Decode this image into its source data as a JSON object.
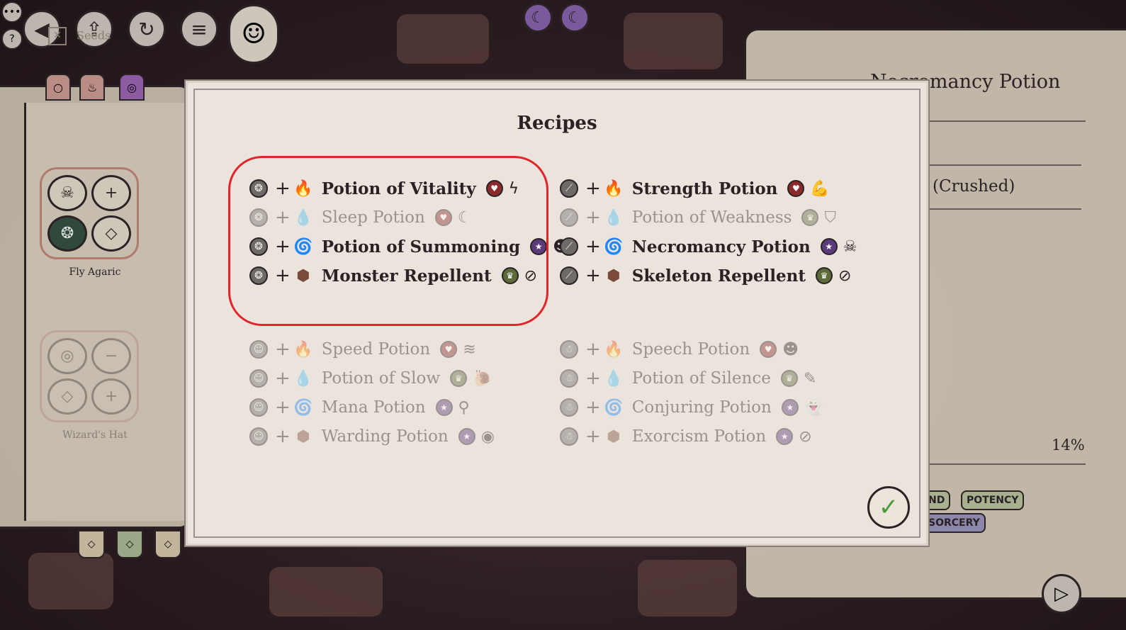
{
  "hud": {
    "back_icon": "◀",
    "upload_icon": "⇪",
    "restart_icon": "↻",
    "menu_icon": "≡",
    "more_icon": "•••",
    "help_icon": "?",
    "portrait_icon": "☺",
    "moon_icon": "☾"
  },
  "left_book": {
    "section_label": "Seeds",
    "ingredients": [
      {
        "name": "Fly Agaric"
      },
      {
        "name": "Wizard's Hat"
      }
    ]
  },
  "right_page": {
    "title": "Necromancy Potion",
    "ingredient_text": "(Crushed)",
    "percent": "14%",
    "tags": [
      "ND",
      "POTENCY",
      "SORCERY"
    ]
  },
  "modal": {
    "title": "Recipes",
    "confirm_icon": "✓"
  },
  "recipes": [
    {
      "name": "Potion of Vitality",
      "base_icon": "❂",
      "elem_icon": "🔥",
      "effect_icon": "♥",
      "effect_color": "#8b2a2a",
      "result_icon": "ϟ",
      "known": true
    },
    {
      "name": "Sleep Potion",
      "base_icon": "❂",
      "elem_icon": "💧",
      "effect_icon": "♥",
      "effect_color": "#8b2a2a",
      "result_icon": "☾",
      "known": false
    },
    {
      "name": "Potion of Summoning",
      "base_icon": "❂",
      "elem_icon": "🌀",
      "effect_icon": "★",
      "effect_color": "#5b3a7a",
      "result_icon": "☻",
      "known": true
    },
    {
      "name": "Monster Repellent",
      "base_icon": "❂",
      "elem_icon": "⬢",
      "effect_icon": "♛",
      "effect_color": "#5d6a3a",
      "result_icon": "⊘",
      "known": true
    },
    {
      "name": "Strength Potion",
      "base_icon": "⟋",
      "elem_icon": "🔥",
      "effect_icon": "♥",
      "effect_color": "#8b2a2a",
      "result_icon": "💪",
      "known": true
    },
    {
      "name": "Potion of Weakness",
      "base_icon": "⟋",
      "elem_icon": "💧",
      "effect_icon": "♛",
      "effect_color": "#5d6a3a",
      "result_icon": "⛉",
      "known": false
    },
    {
      "name": "Necromancy Potion",
      "base_icon": "⟋",
      "elem_icon": "🌀",
      "effect_icon": "★",
      "effect_color": "#5b3a7a",
      "result_icon": "☠",
      "known": true
    },
    {
      "name": "Skeleton Repellent",
      "base_icon": "⟋",
      "elem_icon": "⬢",
      "effect_icon": "♛",
      "effect_color": "#5d6a3a",
      "result_icon": "⊘",
      "known": true
    },
    {
      "name": "Speed Potion",
      "base_icon": "☺",
      "elem_icon": "🔥",
      "effect_icon": "♥",
      "effect_color": "#8b2a2a",
      "result_icon": "≋",
      "known": false
    },
    {
      "name": "Potion of Slow",
      "base_icon": "☺",
      "elem_icon": "💧",
      "effect_icon": "♛",
      "effect_color": "#5d6a3a",
      "result_icon": "🐌",
      "known": false
    },
    {
      "name": "Mana Potion",
      "base_icon": "☺",
      "elem_icon": "🌀",
      "effect_icon": "★",
      "effect_color": "#5b3a7a",
      "result_icon": "⚲",
      "known": false
    },
    {
      "name": "Warding Potion",
      "base_icon": "☺",
      "elem_icon": "⬢",
      "effect_icon": "★",
      "effect_color": "#5b3a7a",
      "result_icon": "◉",
      "known": false
    },
    {
      "name": "Speech Potion",
      "base_icon": "☃",
      "elem_icon": "🔥",
      "effect_icon": "♥",
      "effect_color": "#8b2a2a",
      "result_icon": "☻",
      "known": false
    },
    {
      "name": "Potion of Silence",
      "base_icon": "☃",
      "elem_icon": "💧",
      "effect_icon": "♛",
      "effect_color": "#5d6a3a",
      "result_icon": "✎",
      "known": false
    },
    {
      "name": "Conjuring Potion",
      "base_icon": "☃",
      "elem_icon": "🌀",
      "effect_icon": "★",
      "effect_color": "#5b3a7a",
      "result_icon": "👻",
      "known": false
    },
    {
      "name": "Exorcism Potion",
      "base_icon": "☃",
      "elem_icon": "⬢",
      "effect_icon": "★",
      "effect_color": "#5b3a7a",
      "result_icon": "⊘",
      "known": false
    }
  ],
  "colors": {
    "highlight": "#e0242b",
    "fire": "#d2452a",
    "water": "#9b8d83",
    "arcane": "#9b3fc4",
    "earth": "#7a4a3a"
  }
}
